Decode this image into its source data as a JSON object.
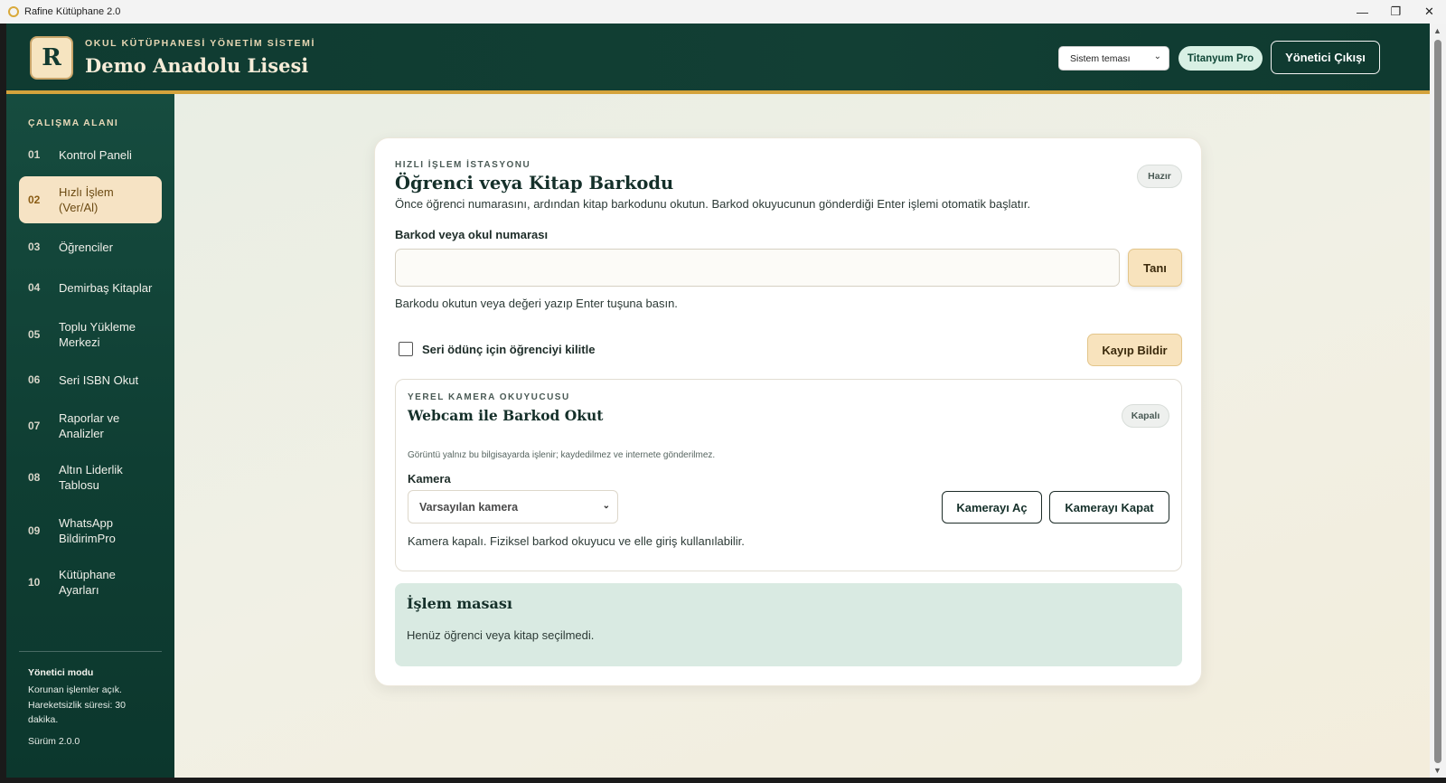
{
  "window": {
    "title": "Rafine Kütüphane 2.0",
    "controls": {
      "minimize": "—",
      "maximize": "❐",
      "close": "✕"
    }
  },
  "header": {
    "logo_letter": "R",
    "subtitle": "OKUL KÜTÜPHANESİ YÖNETİM SİSTEMİ",
    "school_name": "Demo Anadolu Lisesi",
    "theme_select": "Sistem teması",
    "pro_badge": "Titanyum Pro",
    "logout_label": "Yönetici Çıkışı"
  },
  "sidebar": {
    "section_label": "ÇALIŞMA ALANI",
    "items": [
      {
        "num": "01",
        "label": "Kontrol Paneli",
        "active": false
      },
      {
        "num": "02",
        "label": "Hızlı İşlem (Ver/Al)",
        "active": true
      },
      {
        "num": "03",
        "label": "Öğrenciler",
        "active": false
      },
      {
        "num": "04",
        "label": "Demirbaş Kitaplar",
        "active": false
      },
      {
        "num": "05",
        "label": "Toplu Yükleme Merkezi",
        "active": false
      },
      {
        "num": "06",
        "label": "Seri ISBN Okut",
        "active": false
      },
      {
        "num": "07",
        "label": "Raporlar ve Analizler",
        "active": false
      },
      {
        "num": "08",
        "label": "Altın Liderlik Tablosu",
        "active": false
      },
      {
        "num": "09",
        "label": "WhatsApp BildirimPro",
        "active": false
      },
      {
        "num": "10",
        "label": "Kütüphane Ayarları",
        "active": false
      }
    ],
    "admin_title": "Yönetici modu",
    "admin_desc": "Korunan işlemler açık. Hareketsizlik süresi: 30 dakika.",
    "version": "Sürüm 2.0.0"
  },
  "station": {
    "eyebrow": "HIZLI İŞLEM İSTASYONU",
    "title": "Öğrenci veya Kitap Barkodu",
    "status": "Hazır",
    "intro": "Önce öğrenci numarasını, ardından kitap barkodunu okutun. Barkod okuyucunun gönderdiği Enter işlemi otomatik başlatır.",
    "field_label": "Barkod veya okul numarası",
    "input_value": "",
    "recognize_label": "Tanı",
    "hint": "Barkodu okutun veya değeri yazıp Enter tuşuna basın.",
    "lock_label": "Seri ödünç için öğrenciyi kilitle",
    "lock_checked": false,
    "lost_label": "Kayıp Bildir"
  },
  "camera": {
    "eyebrow": "YEREL KAMERA OKUYUCUSU",
    "title": "Webcam ile Barkod Okut",
    "status": "Kapalı",
    "privacy": "Görüntü yalnız bu bilgisayarda işlenir; kaydedilmez ve internete gönderilmez.",
    "camera_label": "Kamera",
    "camera_select": "Varsayılan kamera",
    "open_label": "Kamerayı Aç",
    "close_label": "Kamerayı Kapat",
    "status_text": "Kamera kapalı. Fiziksel barkod okuyucu ve elle giriş kullanılabilir."
  },
  "desk": {
    "title": "İşlem masası",
    "message": "Henüz öğrenci veya kitap seçilmedi."
  },
  "colors": {
    "header_bg": "#0f3b31",
    "accent_gold": "#d4a33c",
    "active_nav_bg": "#f6e3c4",
    "desk_bg": "#d9eae2"
  }
}
